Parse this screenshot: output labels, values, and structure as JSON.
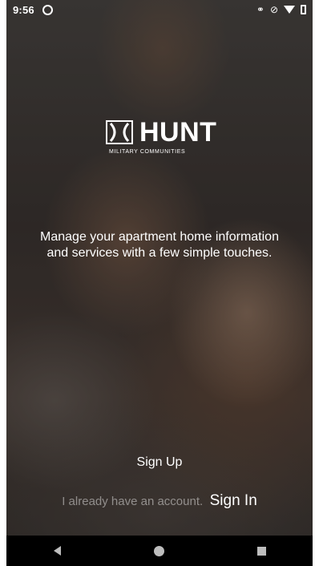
{
  "status_bar": {
    "time": "9:56",
    "icons": [
      "app-notification-icon",
      "link-icon",
      "mute-icon",
      "wifi-icon",
      "battery-icon"
    ]
  },
  "brand": {
    "name": "HUNT",
    "subtitle": "MILITARY COMMUNITIES"
  },
  "tagline": "Manage your apartment home information and services with a few simple touches.",
  "actions": {
    "sign_up": "Sign Up",
    "already_have_account": "I already have an account.",
    "sign_in": "Sign In"
  },
  "nav_bar": {
    "icons": [
      "back-icon",
      "home-icon",
      "recents-icon"
    ]
  },
  "colors": {
    "text": "#ffffff",
    "muted_text": "#8a8684",
    "nav_background": "#000000",
    "nav_icon": "#bdbdbd"
  }
}
